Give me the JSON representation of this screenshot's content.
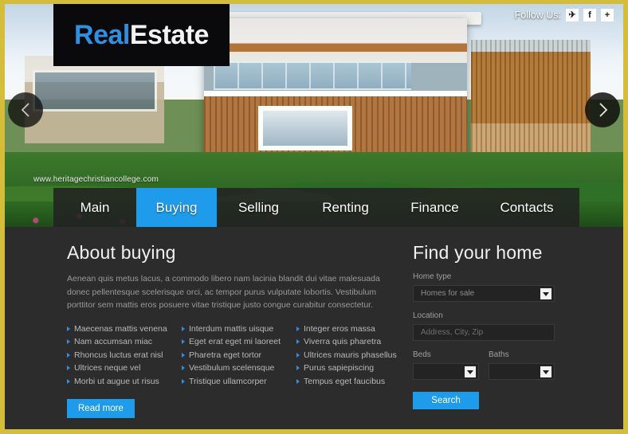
{
  "branding": {
    "logo_primary": "Real",
    "logo_secondary": "Estate"
  },
  "header": {
    "follow_label": "Follow Us:",
    "social": [
      {
        "name": "twitter-icon",
        "glyph": "✈"
      },
      {
        "name": "facebook-icon",
        "glyph": "f"
      },
      {
        "name": "googleplus-icon",
        "glyph": "+"
      }
    ]
  },
  "slider": {
    "prev_label": "‹",
    "next_label": "›"
  },
  "nav": {
    "items": [
      {
        "label": "Main",
        "active": false
      },
      {
        "label": "Buying",
        "active": true
      },
      {
        "label": "Selling",
        "active": false
      },
      {
        "label": "Renting",
        "active": false
      },
      {
        "label": "Finance",
        "active": false
      },
      {
        "label": "Contacts",
        "active": false
      }
    ]
  },
  "about": {
    "title": "About buying",
    "paragraph": "Aenean quis metus lacus, a commodo libero nam lacinia blandit dui vitae malesuada donec pellentesque scelerisque orci, ac tempor purus vulputate lobortis. Vestibulum porttitor sem mattis eros posuere vitae tristique justo congue curabitur consectetur.",
    "read_more_label": "Read more",
    "lists": [
      [
        "Maecenas mattis venena",
        "Nam accumsan miac",
        "Rhoncus luctus erat nisl",
        "Ultrices neque vel",
        "Morbi ut augue ut risus"
      ],
      [
        "Interdum mattis uisque",
        "Eget erat eget mi laoreet",
        "Pharetra eget tortor",
        "Vestibulum scelensque",
        "Tristique ullamcorper"
      ],
      [
        "Integer eros massa",
        "Viverra quis pharetra",
        "Ultrices mauris phasellus",
        "Purus sapiepiscing",
        "Tempus eget faucibus"
      ]
    ]
  },
  "search_form": {
    "title": "Find your home",
    "home_type_label": "Home type",
    "home_type_value": "Homes for sale",
    "location_label": "Location",
    "location_placeholder": "Address, City, Zip",
    "location_value": "",
    "beds_label": "Beds",
    "beds_value": "",
    "baths_label": "Baths",
    "baths_value": "",
    "search_label": "Search"
  },
  "watermark": {
    "text": "www.heritagechristiancollege.com"
  },
  "colors": {
    "accent_blue": "#1e9ceb",
    "border_gold": "#d4bd3a",
    "content_bg": "#2c2c2c",
    "logo_blue": "#2f8fe0"
  }
}
